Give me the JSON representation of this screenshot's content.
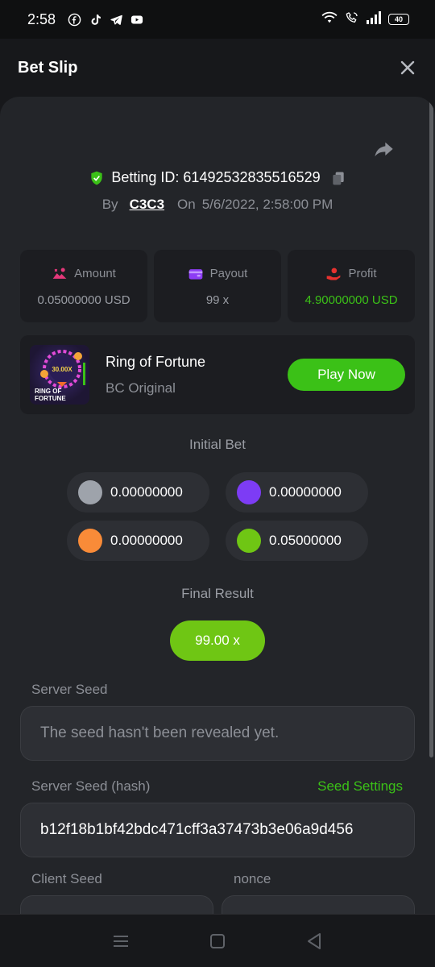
{
  "status_bar": {
    "time": "2:58",
    "battery": "40",
    "app_icons": [
      "facebook-icon",
      "tiktok-icon",
      "telegram-icon",
      "youtube-icon"
    ]
  },
  "header": {
    "title": "Bet Slip"
  },
  "bet_info": {
    "betting_id": "Betting ID: 61492532835516529",
    "by_label": "By",
    "user": "C3C3",
    "on_label": "On",
    "datetime": "5/6/2022, 2:58:00 PM"
  },
  "stats": {
    "amount_label": "Amount",
    "amount_value": "0.05000000 USD",
    "payout_label": "Payout",
    "payout_value": "99 x",
    "profit_label": "Profit",
    "profit_value": "4.90000000 USD"
  },
  "game": {
    "name": "Ring of Fortune",
    "provider": "BC Original",
    "play_label": "Play Now",
    "thumb_multiplier": "30.00X",
    "thumb_title_1": "RING OF",
    "thumb_title_2": "FORTUNE"
  },
  "initial_bet": {
    "title": "Initial Bet",
    "items": [
      {
        "value": "0.00000000",
        "color": "#9ea3ab"
      },
      {
        "value": "0.00000000",
        "color": "#7d3cf5"
      },
      {
        "value": "0.00000000",
        "color": "#f98b38"
      },
      {
        "value": "0.05000000",
        "color": "#6fc614"
      }
    ]
  },
  "final_result": {
    "title": "Final Result",
    "value": "99.00 x"
  },
  "server_seed": {
    "label": "Server Seed",
    "placeholder": "The seed hasn't been revealed yet."
  },
  "server_seed_hash": {
    "label": "Server Seed (hash)",
    "settings_link": "Seed Settings",
    "value": "b12f18b1bf42bdc471cff3a37473b3e06a9d456"
  },
  "client_seed": {
    "label": "Client Seed"
  },
  "nonce": {
    "label": "nonce"
  },
  "colors": {
    "accent_green": "#3bc117",
    "result_green": "#6fc614",
    "panel": "#232529",
    "card": "#1c1d21"
  }
}
